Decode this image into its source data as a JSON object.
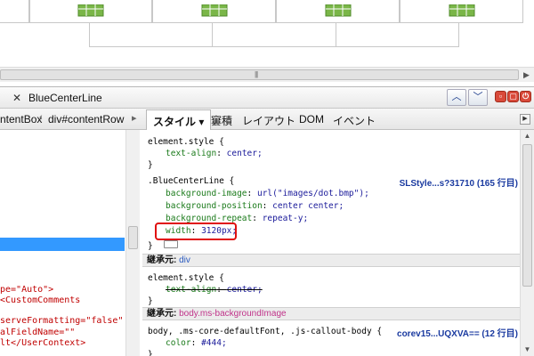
{
  "devtools": {
    "search": {
      "value": "BlueCenterLine"
    },
    "breadcrumb": {
      "item1": "ntentBox",
      "item2": "div#contentRow"
    },
    "tabs": [
      {
        "label": "スタイル ▾"
      },
      {
        "label": "窶積"
      },
      {
        "label": "レイアウト"
      },
      {
        "label": "DOM"
      },
      {
        "label": "イベント"
      }
    ],
    "dom_tree": [
      "pe=\"Auto\">",
      "<CustomComments",
      "serveFormatting=\"false\"",
      "alFieldName=\"\"",
      "lt</UserContext>"
    ],
    "styles": {
      "rule1_selector": "element.style {",
      "rule1_prop": "text-align",
      "rule1_val": "center;",
      "rule1_close": "}",
      "rule2_selector": ".BlueCenterLine {",
      "rule2_source": "SLStyle...s?31710 (165 行目)",
      "rule2_p1": "background-image",
      "rule2_v1": "url(\"images/dot.bmp\");",
      "rule2_p2": "background-position",
      "rule2_v2": "center center;",
      "rule2_p3": "background-repeat",
      "rule2_v3": "repeat-y;",
      "rule2_p4": "width",
      "rule2_v4": "3120px;",
      "rule2_close": "}",
      "inherit1_label": "継承元:",
      "inherit1_target": "div",
      "rule3_selector": "element.style {",
      "rule3_prop": "text-align",
      "rule3_val": "center;",
      "rule3_close": "}",
      "inherit2_label": "継承元:",
      "inherit2_target_a": "body.",
      "inherit2_target_b": "ms-backgroundImage",
      "rule4_selector": "body, .ms-core-defaultFont, .js-callout-body {",
      "rule4_source": "corev15...UQXVA== (12 行目)",
      "rule4_prop": "color",
      "rule4_val": "#444;",
      "rule4_close": "}"
    }
  }
}
